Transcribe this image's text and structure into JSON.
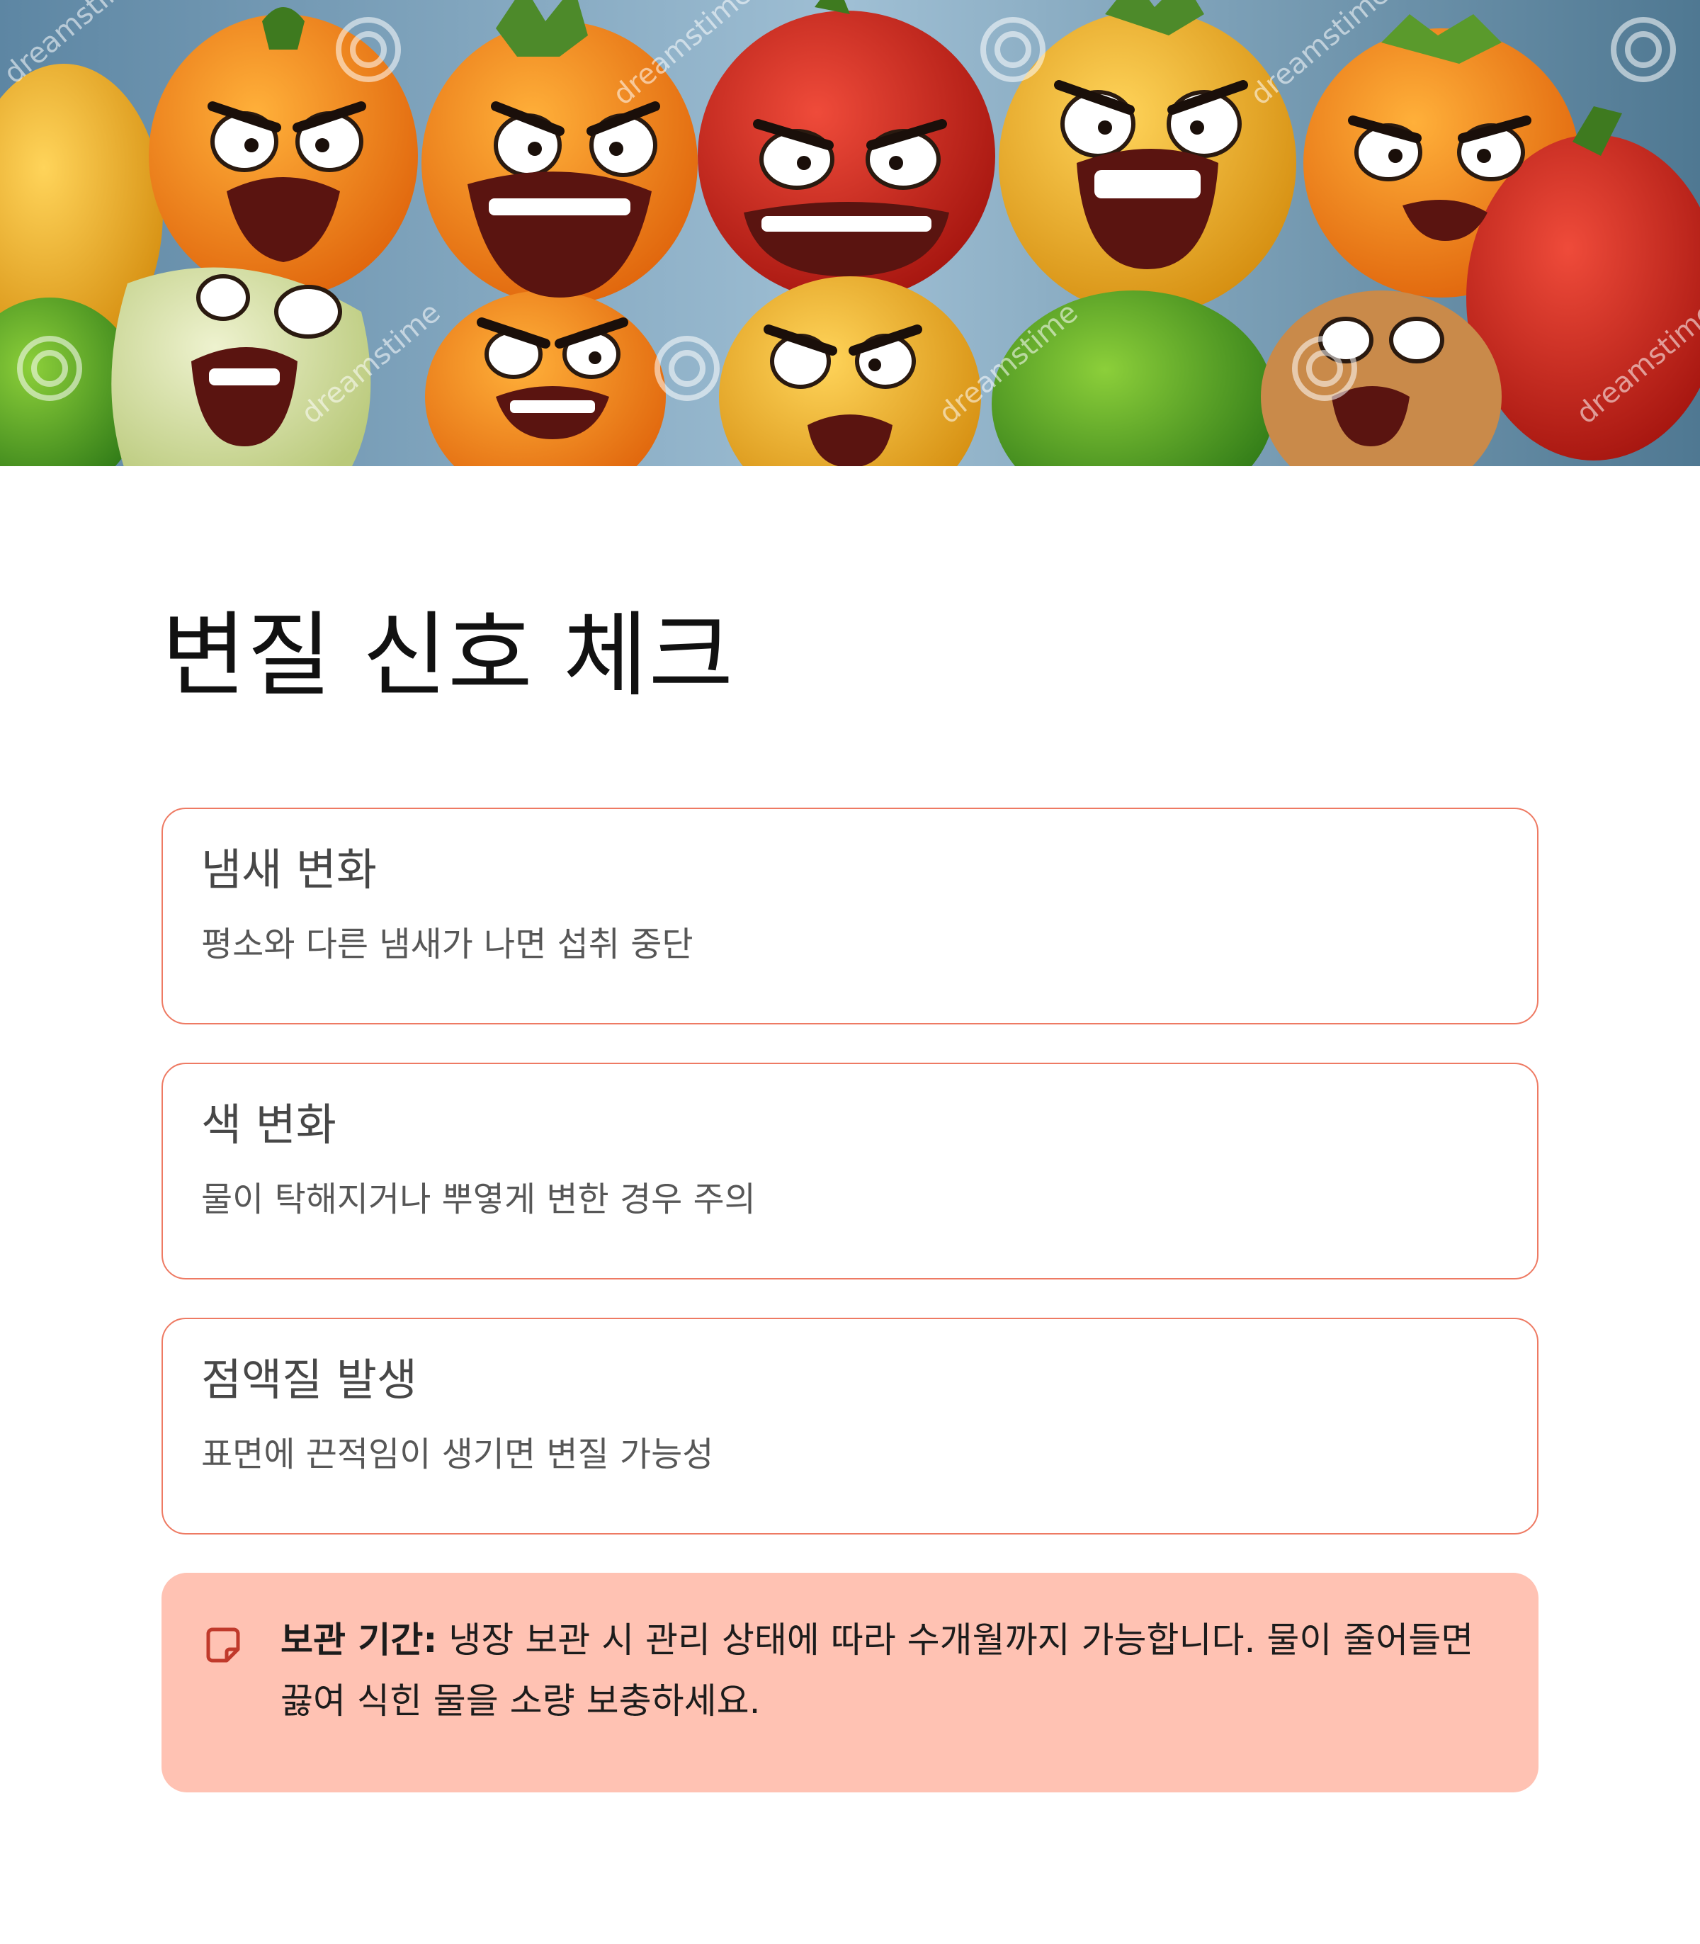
{
  "hero": {
    "image_alt": "angry-vegetables-banner",
    "watermark_text": "dreamstime"
  },
  "page": {
    "title": "변질 신호 체크"
  },
  "cards": [
    {
      "title": "냄새 변화",
      "description": "평소와 다른 냄새가 나면 섭취 중단"
    },
    {
      "title": "색 변화",
      "description": "물이 탁해지거나 뿌옇게 변한 경우 주의"
    },
    {
      "title": "점액질 발생",
      "description": "표면에 끈적임이 생기면 변질 가능성"
    }
  ],
  "note": {
    "icon": "sticky-note-icon",
    "label": "보관 기간:",
    "text": " 냉장 보관 시 관리 상태에 따라 수개월까지 가능합니다. 물이 줄어들면 끓여 식힌 물을 소량 보충하세요."
  },
  "colors": {
    "card_border": "#ee7a63",
    "note_background": "#ffc2b3",
    "note_icon": "#c0392b"
  }
}
